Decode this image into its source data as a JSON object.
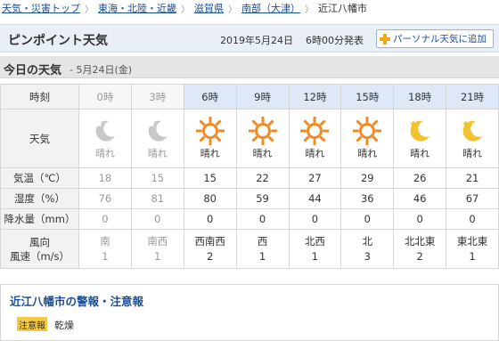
{
  "breadcrumb": [
    "天気・災害トップ",
    "東海・北陸・近畿",
    "滋賀県",
    "南部（大津）",
    "近江八幡市"
  ],
  "header": {
    "title": "ピンポイント天気",
    "date": "2019年5月24日",
    "issued": "6時00分発表",
    "personal_button": "パーソナル天気に追加"
  },
  "section": {
    "title": "今日の天気",
    "date": "- 5月24日(金)"
  },
  "labels": {
    "time": "時刻",
    "weather": "天気",
    "temp": "気温（℃）",
    "humidity": "湿度（%）",
    "precip": "降水量（mm）",
    "wind_dir": "風向",
    "wind_speed": "風速（m/s）"
  },
  "hours": [
    {
      "time": "0時",
      "past": true,
      "icon": "moon-icon",
      "weather": "晴れ",
      "temp": "18",
      "humidity": "76",
      "precip": "0",
      "wind_dir": "南",
      "wind_speed": "1"
    },
    {
      "time": "3時",
      "past": true,
      "icon": "moon-icon",
      "weather": "晴れ",
      "temp": "15",
      "humidity": "81",
      "precip": "0",
      "wind_dir": "南西",
      "wind_speed": "1"
    },
    {
      "time": "6時",
      "past": false,
      "icon": "sun-icon",
      "weather": "晴れ",
      "temp": "15",
      "humidity": "80",
      "precip": "0",
      "wind_dir": "西南西",
      "wind_speed": "2"
    },
    {
      "time": "9時",
      "past": false,
      "icon": "sun-icon",
      "weather": "晴れ",
      "temp": "22",
      "humidity": "59",
      "precip": "0",
      "wind_dir": "西",
      "wind_speed": "1"
    },
    {
      "time": "12時",
      "past": false,
      "icon": "sun-icon",
      "weather": "晴れ",
      "temp": "27",
      "humidity": "44",
      "precip": "0",
      "wind_dir": "北西",
      "wind_speed": "1"
    },
    {
      "time": "15時",
      "past": false,
      "icon": "sun-icon",
      "weather": "晴れ",
      "temp": "29",
      "humidity": "36",
      "precip": "0",
      "wind_dir": "北",
      "wind_speed": "3"
    },
    {
      "time": "18時",
      "past": false,
      "icon": "moon-icon",
      "weather": "晴れ",
      "temp": "26",
      "humidity": "46",
      "precip": "0",
      "wind_dir": "北北東",
      "wind_speed": "2"
    },
    {
      "time": "21時",
      "past": false,
      "icon": "moon-icon",
      "weather": "晴れ",
      "temp": "21",
      "humidity": "67",
      "precip": "0",
      "wind_dir": "東北東",
      "wind_speed": "1"
    }
  ],
  "warnings": {
    "title": "近江八幡市の警報・注意報",
    "badge": "注意報",
    "item": "乾燥"
  },
  "colors": {
    "link": "#1a4f9c",
    "sun": "#f08a24",
    "moon": "#f2c230",
    "moon_past": "#c8c8c8",
    "advisory_badge": "#f5c842"
  }
}
